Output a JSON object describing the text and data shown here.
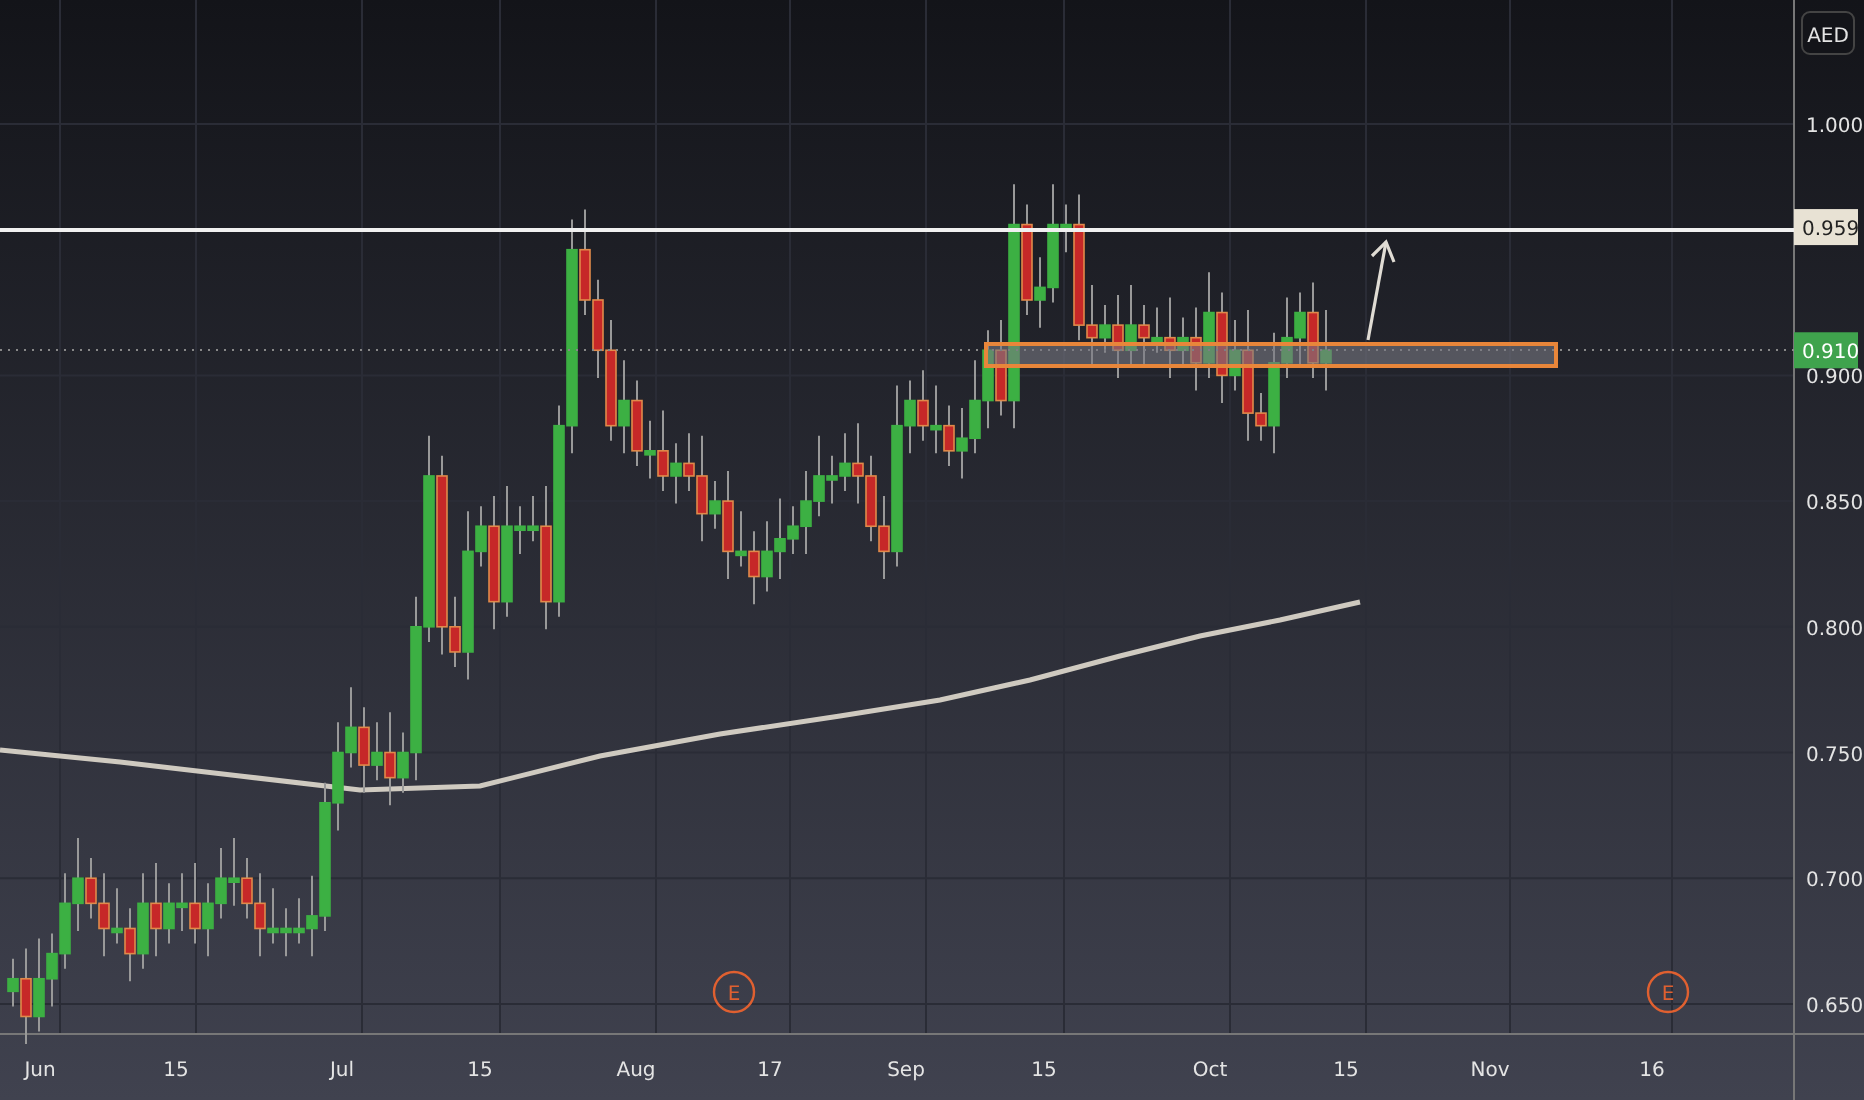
{
  "chart": {
    "currency": "AED",
    "y_ticks": [
      "1.000",
      "0.900",
      "0.850",
      "0.800",
      "0.750",
      "0.700",
      "0.650"
    ],
    "x_ticks": [
      "Jun",
      "15",
      "Jul",
      "15",
      "Aug",
      "17",
      "Sep",
      "15",
      "Oct",
      "15",
      "Nov",
      "16"
    ],
    "price_labels": [
      {
        "text": "0.959",
        "kind": "line"
      },
      {
        "text": "0.910",
        "kind": "last"
      }
    ],
    "event_markers": [
      {
        "text": "E"
      },
      {
        "text": "E"
      }
    ]
  }
}
